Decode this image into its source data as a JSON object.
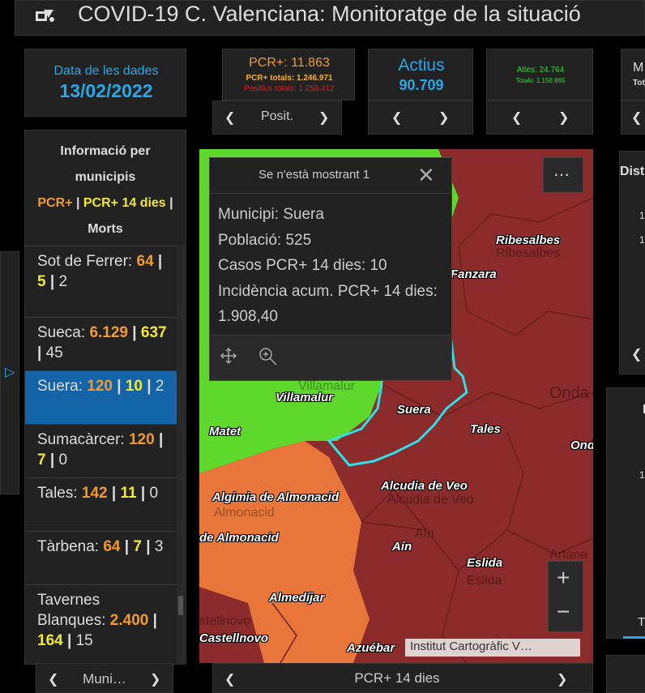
{
  "header": {
    "title": "COVID-19 C. Valenciana: Monitoratge de la situació"
  },
  "date": {
    "label": "Data de les dades",
    "value": "13/02/2022"
  },
  "pcr": {
    "main": "PCR+: 11.863",
    "total": "PCR+ totals: 1.246.971",
    "positives": "Positius totals: 1.258.412",
    "nav_label": "Posit."
  },
  "actius": {
    "label": "Actius",
    "value": "90.709"
  },
  "altes": {
    "main": "Altes: 24.764",
    "total": "Totals: 1.158.865"
  },
  "morts_partial": {
    "label": "M",
    "sub": "Tot"
  },
  "list": {
    "heading_1": "Informació per",
    "heading_2": "municipis",
    "legend_pcr": "PCR+",
    "legend_pcr14": "PCR+ 14 dies",
    "legend_sep": "|",
    "legend_morts": "Morts",
    "nav_label": "Muni…",
    "items": [
      {
        "name": "Sot de Ferrer:",
        "pcr": "64",
        "pcr14": "5",
        "morts": "2"
      },
      {
        "name": "Sueca:",
        "pcr": "6.129",
        "pcr14": "637",
        "morts": "45"
      },
      {
        "name": "Suera:",
        "pcr": "120",
        "pcr14": "10",
        "morts": "2"
      },
      {
        "name": "Sumacàrcer:",
        "pcr": "120",
        "pcr14": "7",
        "morts": "0"
      },
      {
        "name": "Tales:",
        "pcr": "142",
        "pcr14": "11",
        "morts": "0"
      },
      {
        "name": "Tàrbena:",
        "pcr": "64",
        "pcr14": "7",
        "morts": "3"
      },
      {
        "name": "Tavernes Blanques:",
        "pcr": "2.400",
        "pcr14": "164",
        "morts": "15"
      }
    ]
  },
  "popup": {
    "title": "Se n'està mostrant 1",
    "municipi": "Municipi: Suera",
    "poblacio": "Població: 525",
    "casos": "Casos PCR+ 14 dies: 10",
    "incidencia": "Incidència acum. PCR+ 14 dies: 1.908,40"
  },
  "map": {
    "labels": [
      "Ribesalbes",
      "Fanzara",
      "Villamalur",
      "Suera",
      "Tales",
      "Matet",
      "Alcudia de Veo",
      "Algimia de Almonacid",
      "de Almonacid",
      "Aín",
      "Eslida",
      "Almedíjar",
      "Castellnovo",
      "Azuébar",
      "Onda"
    ],
    "ghost_labels": [
      "Ribesalbes",
      "Villamalur",
      "Alcudia de Veo",
      "Almonacid",
      "Aín",
      "Eslida",
      "Onda",
      "Artana",
      "stellnovo"
    ],
    "attribution": "Institut Cartogràfic V…",
    "nav_label": "PCR+ 14 dies",
    "colors": {
      "high": "#8b2b2b",
      "medium": "#e8763a",
      "low": "#5fd82e",
      "outline": "#2fe0e8"
    }
  },
  "right": {
    "dist_label": "Dist",
    "val1": "1",
    "val2": "1",
    "p2_label": "D",
    "p2_val": "1",
    "p2_tab": "T"
  }
}
